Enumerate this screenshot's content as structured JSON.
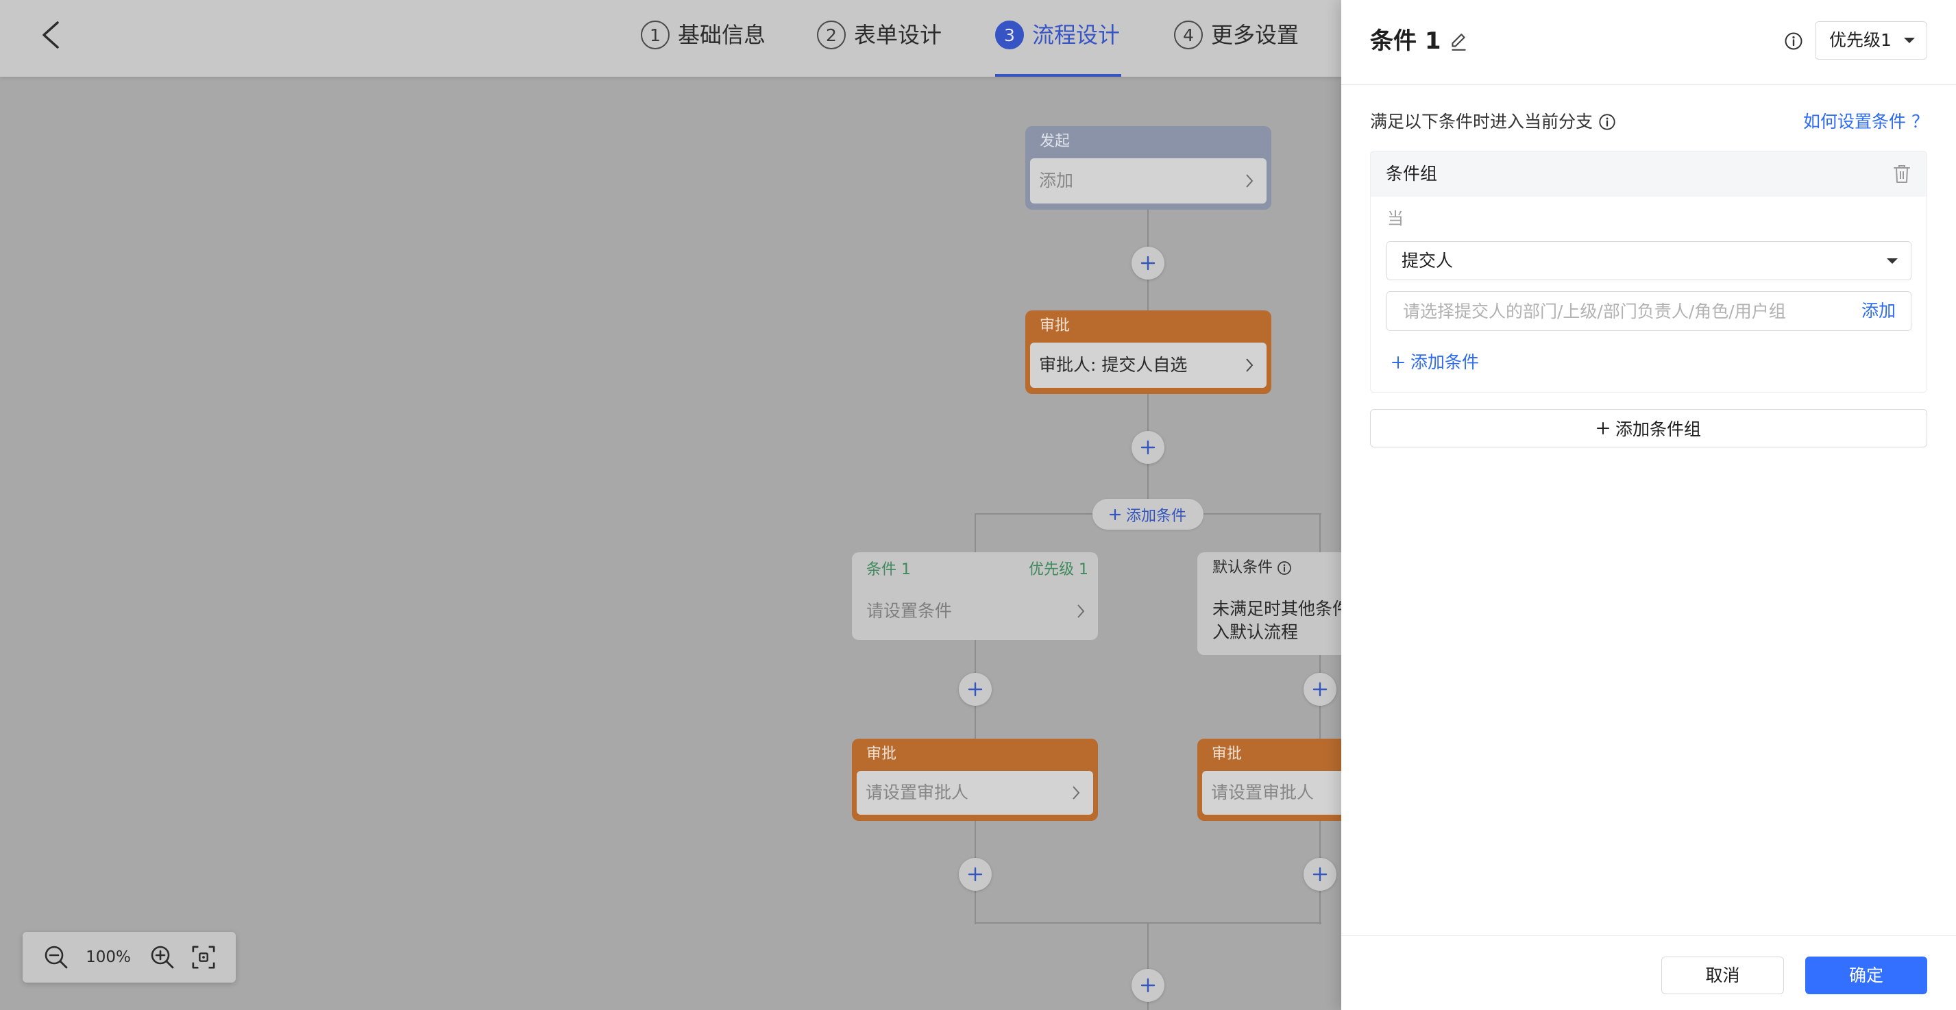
{
  "header": {
    "steps": [
      {
        "num": "1",
        "label": "基础信息"
      },
      {
        "num": "2",
        "label": "表单设计"
      },
      {
        "num": "3",
        "label": "流程设计"
      },
      {
        "num": "4",
        "label": "更多设置"
      }
    ],
    "active_step": "3"
  },
  "flow": {
    "start_node": {
      "type": "发起",
      "value": "添加"
    },
    "approver_node": {
      "type": "审批",
      "value": "审批人: 提交人自选"
    },
    "add_condition": "添加条件",
    "branches": [
      {
        "title": "条件 1",
        "priority": "优先级 1",
        "value": "请设置条件",
        "approval": {
          "type": "审批",
          "value": "请设置审批人"
        }
      },
      {
        "title": "默认条件",
        "description": [
          "未满足时其他条件",
          "入默认流程"
        ],
        "approval": {
          "type": "审批",
          "value": "请设置审批人"
        }
      }
    ]
  },
  "zoom": {
    "level": "100%"
  },
  "panel": {
    "title": "条件 1",
    "priority_select": "优先级1",
    "intro": "满足以下条件时进入当前分支",
    "help_link": "如何设置条件 ？",
    "condition_group": {
      "title": "条件组",
      "when_label": "当",
      "field_select": "提交人",
      "value_placeholder": "请选择提交人的部门/上级/部门负责人/角色/用户组",
      "value_add": "添加",
      "add_condition": "添加条件"
    },
    "add_group": "添加条件组",
    "cancel": "取消",
    "confirm": "确定"
  },
  "colors": {
    "accent": "#3370ff",
    "link": "#2e6bf0",
    "approval_node": "#b86b2d",
    "start_node": "#8a93a8",
    "condition_title": "#3e8a5c",
    "mask_canvas": "#a8a8a8"
  },
  "icons": [
    "back-arrow-icon",
    "plus-icon",
    "chevron-right-icon",
    "info-icon",
    "edit-icon",
    "trash-icon",
    "caret-down-icon",
    "zoom-out-icon",
    "zoom-in-icon",
    "fit-screen-icon"
  ]
}
